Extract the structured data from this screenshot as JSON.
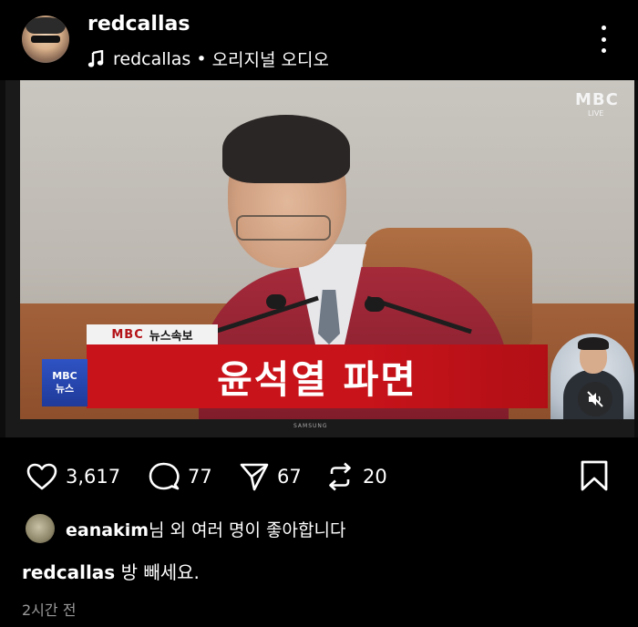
{
  "post": {
    "username": "redcallas",
    "audio_user": "redcallas",
    "audio_separator": "•",
    "audio_label": "오리지널 오디오"
  },
  "video": {
    "broadcaster_logo": "MBC",
    "live_label": "LIVE",
    "tag_logo": "MBC",
    "tag_label": "뉴스속보",
    "headline": "윤석열 파면",
    "side_logo_top": "MBC",
    "side_logo_bottom": "뉴스",
    "tv_brand": "SAMSUNG",
    "muted": true
  },
  "actions": {
    "likes": "3,617",
    "comments": "77",
    "shares": "67",
    "reposts": "20"
  },
  "likes_summary": {
    "liker": "eanakim",
    "rest": "님 외 여러 명이 좋아합니다"
  },
  "caption": {
    "author": "redcallas",
    "text": " 방 빼세요."
  },
  "timestamp": "2시간 전",
  "colors": {
    "background": "#000000",
    "chyron_red": "#c8131a",
    "muted_text": "#9a9a9a"
  }
}
